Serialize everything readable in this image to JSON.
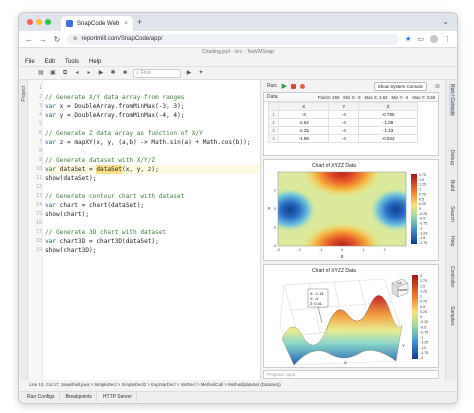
{
  "browser": {
    "tab_title": "SnapCode Web",
    "tab_close": "×",
    "new_tab": "+",
    "url": "reportmill.com/SnapCode/app/"
  },
  "app": {
    "window_title": "Charting.jepl - /src - TeaVMSnap",
    "menus": [
      "File",
      "Edit",
      "Tools",
      "Help"
    ],
    "search_placeholder": "Find",
    "left_tabs": [
      "Project"
    ],
    "right_tabs": [
      "Run / Console",
      "Debug",
      "Build",
      "Search",
      "Help",
      "Controller",
      "Samples"
    ]
  },
  "editor": {
    "lines": [
      {
        "n": "1",
        "parts": [
          {
            "t": "",
            "c": "tx"
          }
        ]
      },
      {
        "n": "2",
        "parts": [
          {
            "t": "// Generate X/Y data array from ranges",
            "c": "cm"
          }
        ]
      },
      {
        "n": "3",
        "parts": [
          {
            "t": "var",
            "c": "kw"
          },
          {
            "t": " x = DoubleArray.fromMinMax(-3, 3);",
            "c": "tx"
          }
        ]
      },
      {
        "n": "4",
        "parts": [
          {
            "t": "var",
            "c": "kw"
          },
          {
            "t": " y = DoubleArray.fromMinMax(-4, 4);",
            "c": "tx"
          }
        ]
      },
      {
        "n": "5",
        "parts": [
          {
            "t": "",
            "c": "tx"
          }
        ]
      },
      {
        "n": "6",
        "parts": [
          {
            "t": "// Generate Z data array as function of X/Y",
            "c": "cm"
          }
        ]
      },
      {
        "n": "7",
        "parts": [
          {
            "t": "var",
            "c": "kw"
          },
          {
            "t": " z = mapXY(x, y, (a,b) -> Math.sin(a) + Math.cos(b));",
            "c": "tx"
          }
        ]
      },
      {
        "n": "8",
        "parts": [
          {
            "t": "",
            "c": "tx"
          }
        ]
      },
      {
        "n": "9",
        "parts": [
          {
            "t": "// Generate dataset with X/Y/Z",
            "c": "cm"
          }
        ]
      },
      {
        "n": "10",
        "parts": [
          {
            "t": "var",
            "c": "kw"
          },
          {
            "t": " dataSet = ",
            "c": "tx"
          },
          {
            "t": "dataSet",
            "c": "hl"
          },
          {
            "t": "(x, y, z);",
            "c": "tx"
          }
        ]
      },
      {
        "n": "11",
        "parts": [
          {
            "t": "show(dataSet);",
            "c": "tx"
          }
        ]
      },
      {
        "n": "12",
        "parts": [
          {
            "t": "",
            "c": "tx"
          }
        ]
      },
      {
        "n": "13",
        "parts": [
          {
            "t": "// Generate contour chart with dataset",
            "c": "cm"
          }
        ]
      },
      {
        "n": "14",
        "parts": [
          {
            "t": "var",
            "c": "kw"
          },
          {
            "t": " chart = chart(dataSet);",
            "c": "tx"
          }
        ]
      },
      {
        "n": "15",
        "parts": [
          {
            "t": "show(chart);",
            "c": "tx"
          }
        ]
      },
      {
        "n": "16",
        "parts": [
          {
            "t": "",
            "c": "tx"
          }
        ]
      },
      {
        "n": "17",
        "parts": [
          {
            "t": "// Generate 3D chart with dataset",
            "c": "cm"
          }
        ]
      },
      {
        "n": "18",
        "parts": [
          {
            "t": "var",
            "c": "kw"
          },
          {
            "t": " chart3D = chart3D(dataSet);",
            "c": "tx"
          }
        ]
      },
      {
        "n": "19",
        "parts": [
          {
            "t": "show(chart3D);",
            "c": "tx"
          }
        ]
      }
    ]
  },
  "statusbar": "Line 10, Col 17: JavaShell.java > SimpleDecl > SimpleDecl2 > ExprVarDecl > VarDecl > MethodCall > Method(dataSet (DataSet))",
  "bottom_tabs": [
    "Run Configs",
    "Breakpoints",
    "HTTP Server"
  ],
  "runpanel": {
    "run_label": "Run:",
    "system_console_button": "Show System Console",
    "program_input_placeholder": "Program input"
  },
  "datawin": {
    "title": "Data",
    "points": "Points: 266",
    "min_x": "Min X: -3",
    "max_x": "Max X: 2.62",
    "min_y": "Min Y: -4",
    "max_y": "Max Y: 3.59",
    "headers": [
      "",
      "X",
      "Y",
      "Z"
    ],
    "rows": [
      [
        "1",
        "-3",
        "-4",
        "-0.795"
      ],
      [
        "2",
        "-2.62",
        "-4",
        "-1.09"
      ],
      [
        "3",
        "-2.25",
        "-4",
        "-1.43"
      ],
      [
        "4",
        "-1.88",
        "-4",
        "-0.942"
      ]
    ]
  },
  "contour_chart": {
    "title": "Chart of XYZZ Data",
    "xlabel": "X",
    "ylabel": "Y",
    "x_ticks": [
      "-3",
      "-2",
      "-1",
      "0",
      "1",
      "2"
    ],
    "y_ticks": [
      "-4",
      "-2",
      "0",
      "2"
    ],
    "legend": [
      "1.75",
      "1.5",
      "1.25",
      "1",
      "0.75",
      "0.5",
      "0.25",
      "0",
      "-0.25",
      "-0.5",
      "-0.75",
      "-1",
      "-1.24",
      "-1.5",
      "-1.75"
    ]
  },
  "chart3d": {
    "title": "Chart of XYZZ Data",
    "tooltip": [
      "X: -1.13",
      "Y: -4",
      "Z: 0.41"
    ],
    "legend": [
      "2",
      "1.75",
      "1.5",
      "1.25",
      "1",
      "0.75",
      "0.5",
      "0.25",
      "0",
      "-0.25",
      "-0.5",
      "-0.75",
      "-1",
      "-1.25",
      "-1.5",
      "-1.75",
      "-2"
    ],
    "cube_labels": [
      "TOP",
      "FRONT"
    ],
    "axis_labels": [
      "X",
      "Y"
    ]
  },
  "colors": {
    "accent": "#1a73e8",
    "comment": "#3b7d3b",
    "keyword": "#1f4fb5",
    "highlight": "#fbe28a"
  }
}
